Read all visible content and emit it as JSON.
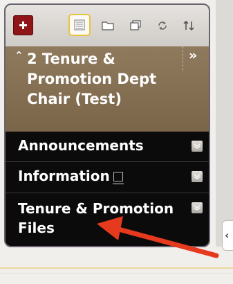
{
  "toolbar": {
    "add_icon": "plus-icon",
    "accent_red": "#8e1518",
    "selected_outline": "#e8c53e",
    "icons": [
      "list-view-icon",
      "folder-icon",
      "windows-icon",
      "refresh-icon",
      "sort-icon"
    ]
  },
  "course": {
    "title": "2 Tenure & Promotion Dept Chair (Test)",
    "collapse_glyph": "⌃",
    "expand_glyph": "»",
    "header_color": "#7f6a4f"
  },
  "menu": {
    "items": [
      {
        "label": "Announcements"
      },
      {
        "label": "Information"
      },
      {
        "label": "Tenure & Promotion Files"
      }
    ]
  },
  "side_tab": {
    "glyph": "‹"
  },
  "annotation": {
    "color": "#e63a1e",
    "points_to": "Tenure & Promotion Files"
  }
}
